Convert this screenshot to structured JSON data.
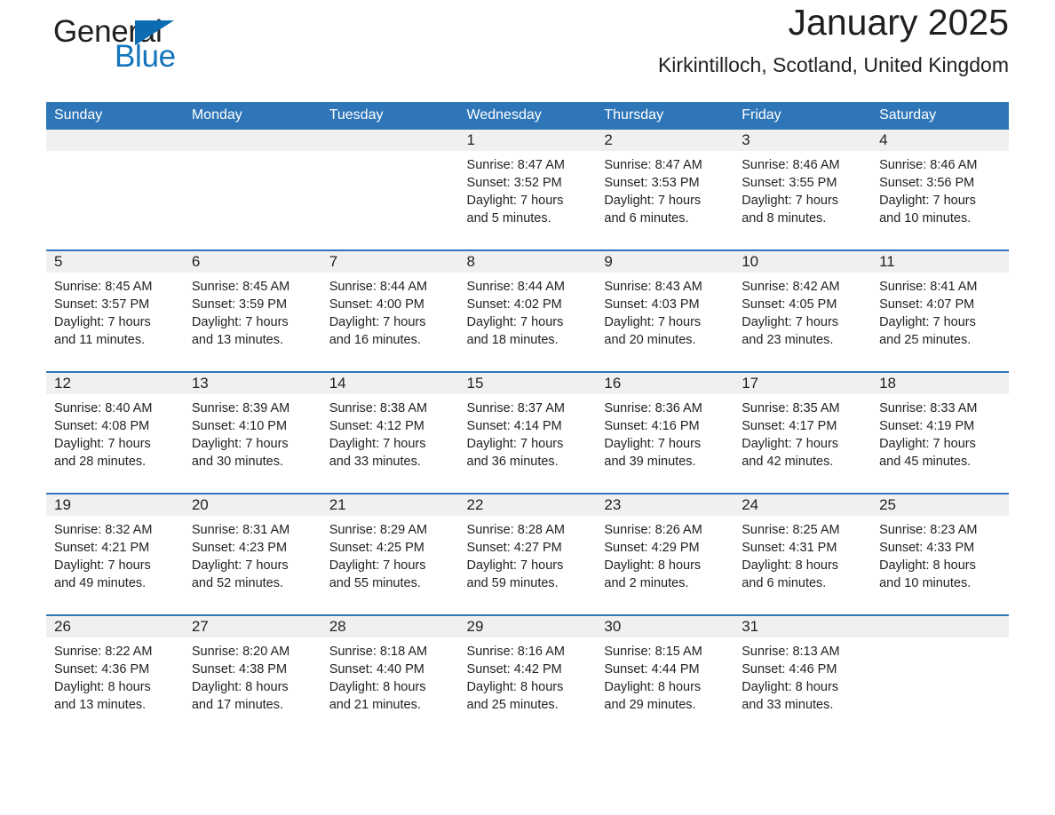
{
  "brand": {
    "name_part1": "General",
    "name_part2": "Blue",
    "logo_icon": "blue-triangle-icon",
    "accent_color": "#0b6cb3"
  },
  "header": {
    "title": "January 2025",
    "subtitle": "Kirkintilloch, Scotland, United Kingdom"
  },
  "theme": {
    "header_bg": "#2e76b8",
    "daynum_bg": "#f0f0f0",
    "text_color": "#231f20"
  },
  "weekday_headers": [
    "Sunday",
    "Monday",
    "Tuesday",
    "Wednesday",
    "Thursday",
    "Friday",
    "Saturday"
  ],
  "weeks": [
    [
      {
        "day": "",
        "blank": true,
        "l1": "",
        "l2": "",
        "l3": "",
        "l4": ""
      },
      {
        "day": "",
        "blank": true,
        "l1": "",
        "l2": "",
        "l3": "",
        "l4": ""
      },
      {
        "day": "",
        "blank": true,
        "l1": "",
        "l2": "",
        "l3": "",
        "l4": ""
      },
      {
        "day": "1",
        "blank": false,
        "l1": "Sunrise: 8:47 AM",
        "l2": "Sunset: 3:52 PM",
        "l3": "Daylight: 7 hours",
        "l4": "and 5 minutes."
      },
      {
        "day": "2",
        "blank": false,
        "l1": "Sunrise: 8:47 AM",
        "l2": "Sunset: 3:53 PM",
        "l3": "Daylight: 7 hours",
        "l4": "and 6 minutes."
      },
      {
        "day": "3",
        "blank": false,
        "l1": "Sunrise: 8:46 AM",
        "l2": "Sunset: 3:55 PM",
        "l3": "Daylight: 7 hours",
        "l4": "and 8 minutes."
      },
      {
        "day": "4",
        "blank": false,
        "l1": "Sunrise: 8:46 AM",
        "l2": "Sunset: 3:56 PM",
        "l3": "Daylight: 7 hours",
        "l4": "and 10 minutes."
      }
    ],
    [
      {
        "day": "5",
        "blank": false,
        "l1": "Sunrise: 8:45 AM",
        "l2": "Sunset: 3:57 PM",
        "l3": "Daylight: 7 hours",
        "l4": "and 11 minutes."
      },
      {
        "day": "6",
        "blank": false,
        "l1": "Sunrise: 8:45 AM",
        "l2": "Sunset: 3:59 PM",
        "l3": "Daylight: 7 hours",
        "l4": "and 13 minutes."
      },
      {
        "day": "7",
        "blank": false,
        "l1": "Sunrise: 8:44 AM",
        "l2": "Sunset: 4:00 PM",
        "l3": "Daylight: 7 hours",
        "l4": "and 16 minutes."
      },
      {
        "day": "8",
        "blank": false,
        "l1": "Sunrise: 8:44 AM",
        "l2": "Sunset: 4:02 PM",
        "l3": "Daylight: 7 hours",
        "l4": "and 18 minutes."
      },
      {
        "day": "9",
        "blank": false,
        "l1": "Sunrise: 8:43 AM",
        "l2": "Sunset: 4:03 PM",
        "l3": "Daylight: 7 hours",
        "l4": "and 20 minutes."
      },
      {
        "day": "10",
        "blank": false,
        "l1": "Sunrise: 8:42 AM",
        "l2": "Sunset: 4:05 PM",
        "l3": "Daylight: 7 hours",
        "l4": "and 23 minutes."
      },
      {
        "day": "11",
        "blank": false,
        "l1": "Sunrise: 8:41 AM",
        "l2": "Sunset: 4:07 PM",
        "l3": "Daylight: 7 hours",
        "l4": "and 25 minutes."
      }
    ],
    [
      {
        "day": "12",
        "blank": false,
        "l1": "Sunrise: 8:40 AM",
        "l2": "Sunset: 4:08 PM",
        "l3": "Daylight: 7 hours",
        "l4": "and 28 minutes."
      },
      {
        "day": "13",
        "blank": false,
        "l1": "Sunrise: 8:39 AM",
        "l2": "Sunset: 4:10 PM",
        "l3": "Daylight: 7 hours",
        "l4": "and 30 minutes."
      },
      {
        "day": "14",
        "blank": false,
        "l1": "Sunrise: 8:38 AM",
        "l2": "Sunset: 4:12 PM",
        "l3": "Daylight: 7 hours",
        "l4": "and 33 minutes."
      },
      {
        "day": "15",
        "blank": false,
        "l1": "Sunrise: 8:37 AM",
        "l2": "Sunset: 4:14 PM",
        "l3": "Daylight: 7 hours",
        "l4": "and 36 minutes."
      },
      {
        "day": "16",
        "blank": false,
        "l1": "Sunrise: 8:36 AM",
        "l2": "Sunset: 4:16 PM",
        "l3": "Daylight: 7 hours",
        "l4": "and 39 minutes."
      },
      {
        "day": "17",
        "blank": false,
        "l1": "Sunrise: 8:35 AM",
        "l2": "Sunset: 4:17 PM",
        "l3": "Daylight: 7 hours",
        "l4": "and 42 minutes."
      },
      {
        "day": "18",
        "blank": false,
        "l1": "Sunrise: 8:33 AM",
        "l2": "Sunset: 4:19 PM",
        "l3": "Daylight: 7 hours",
        "l4": "and 45 minutes."
      }
    ],
    [
      {
        "day": "19",
        "blank": false,
        "l1": "Sunrise: 8:32 AM",
        "l2": "Sunset: 4:21 PM",
        "l3": "Daylight: 7 hours",
        "l4": "and 49 minutes."
      },
      {
        "day": "20",
        "blank": false,
        "l1": "Sunrise: 8:31 AM",
        "l2": "Sunset: 4:23 PM",
        "l3": "Daylight: 7 hours",
        "l4": "and 52 minutes."
      },
      {
        "day": "21",
        "blank": false,
        "l1": "Sunrise: 8:29 AM",
        "l2": "Sunset: 4:25 PM",
        "l3": "Daylight: 7 hours",
        "l4": "and 55 minutes."
      },
      {
        "day": "22",
        "blank": false,
        "l1": "Sunrise: 8:28 AM",
        "l2": "Sunset: 4:27 PM",
        "l3": "Daylight: 7 hours",
        "l4": "and 59 minutes."
      },
      {
        "day": "23",
        "blank": false,
        "l1": "Sunrise: 8:26 AM",
        "l2": "Sunset: 4:29 PM",
        "l3": "Daylight: 8 hours",
        "l4": "and 2 minutes."
      },
      {
        "day": "24",
        "blank": false,
        "l1": "Sunrise: 8:25 AM",
        "l2": "Sunset: 4:31 PM",
        "l3": "Daylight: 8 hours",
        "l4": "and 6 minutes."
      },
      {
        "day": "25",
        "blank": false,
        "l1": "Sunrise: 8:23 AM",
        "l2": "Sunset: 4:33 PM",
        "l3": "Daylight: 8 hours",
        "l4": "and 10 minutes."
      }
    ],
    [
      {
        "day": "26",
        "blank": false,
        "l1": "Sunrise: 8:22 AM",
        "l2": "Sunset: 4:36 PM",
        "l3": "Daylight: 8 hours",
        "l4": "and 13 minutes."
      },
      {
        "day": "27",
        "blank": false,
        "l1": "Sunrise: 8:20 AM",
        "l2": "Sunset: 4:38 PM",
        "l3": "Daylight: 8 hours",
        "l4": "and 17 minutes."
      },
      {
        "day": "28",
        "blank": false,
        "l1": "Sunrise: 8:18 AM",
        "l2": "Sunset: 4:40 PM",
        "l3": "Daylight: 8 hours",
        "l4": "and 21 minutes."
      },
      {
        "day": "29",
        "blank": false,
        "l1": "Sunrise: 8:16 AM",
        "l2": "Sunset: 4:42 PM",
        "l3": "Daylight: 8 hours",
        "l4": "and 25 minutes."
      },
      {
        "day": "30",
        "blank": false,
        "l1": "Sunrise: 8:15 AM",
        "l2": "Sunset: 4:44 PM",
        "l3": "Daylight: 8 hours",
        "l4": "and 29 minutes."
      },
      {
        "day": "31",
        "blank": false,
        "l1": "Sunrise: 8:13 AM",
        "l2": "Sunset: 4:46 PM",
        "l3": "Daylight: 8 hours",
        "l4": "and 33 minutes."
      },
      {
        "day": "",
        "blank": true,
        "l1": "",
        "l2": "",
        "l3": "",
        "l4": ""
      }
    ]
  ]
}
